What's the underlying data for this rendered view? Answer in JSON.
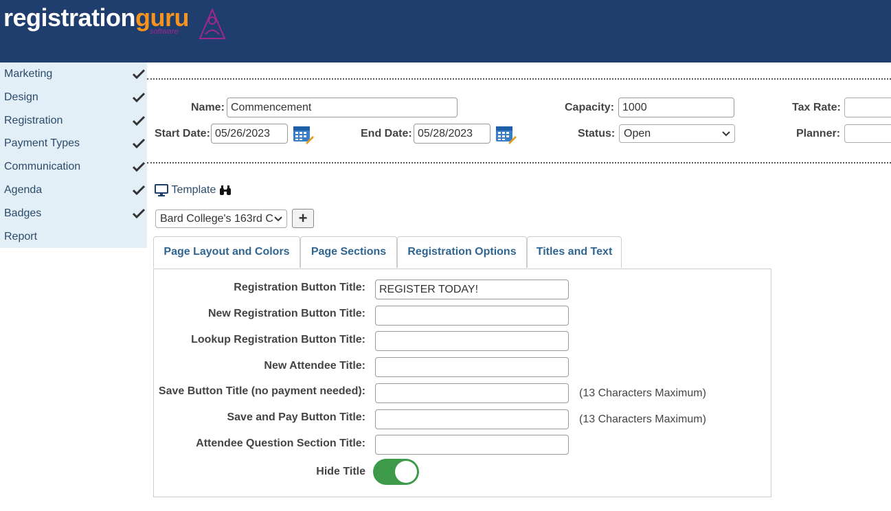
{
  "brand": {
    "name_main": "registration",
    "name_accent": "guru",
    "sub": "software",
    "main_color": "#ffffff",
    "accent_color": "#f7941d",
    "header_bg": "#1f3d6d"
  },
  "sidebar": {
    "items": [
      {
        "label": "Marketing",
        "checked": true
      },
      {
        "label": "Design",
        "checked": true
      },
      {
        "label": "Registration",
        "checked": true
      },
      {
        "label": "Payment Types",
        "checked": true
      },
      {
        "label": "Communication",
        "checked": true
      },
      {
        "label": "Agenda",
        "checked": true
      },
      {
        "label": "Badges",
        "checked": true
      },
      {
        "label": "Report",
        "checked": false
      }
    ]
  },
  "event": {
    "name_label": "Name:",
    "name_value": "Commencement",
    "capacity_label": "Capacity:",
    "capacity_value": "1000",
    "tax_rate_label": "Tax Rate:",
    "tax_rate_value": "",
    "start_date_label": "Start Date:",
    "start_date_value": "05/26/2023",
    "end_date_label": "End Date:",
    "end_date_value": "05/28/2023",
    "status_label": "Status:",
    "status_value": "Open",
    "planner_label": "Planner:",
    "planner_value": ""
  },
  "template": {
    "label": "Template",
    "selected": "Bard College's 163rd C",
    "add_label": "+"
  },
  "tabs": [
    {
      "label": "Page Layout and Colors"
    },
    {
      "label": "Page Sections"
    },
    {
      "label": "Registration Options"
    },
    {
      "label": "Titles and Text"
    }
  ],
  "form": {
    "fields": [
      {
        "label": "Registration Button Title:",
        "value": "REGISTER TODAY!",
        "note": ""
      },
      {
        "label": "New Registration Button Title:",
        "value": "",
        "note": ""
      },
      {
        "label": "Lookup Registration Button Title:",
        "value": "",
        "note": ""
      },
      {
        "label": "New Attendee Title:",
        "value": "",
        "note": ""
      },
      {
        "label": "Save Button Title (no payment needed):",
        "value": "",
        "note": "(13 Characters Maximum)"
      },
      {
        "label": "Save and Pay Button Title:",
        "value": "",
        "note": "(13 Characters Maximum)"
      },
      {
        "label": "Attendee Question Section Title:",
        "value": "",
        "note": ""
      }
    ],
    "hide_title_label": "Hide Title",
    "hide_title_on": true,
    "toggle_color": "#3c9a48"
  }
}
